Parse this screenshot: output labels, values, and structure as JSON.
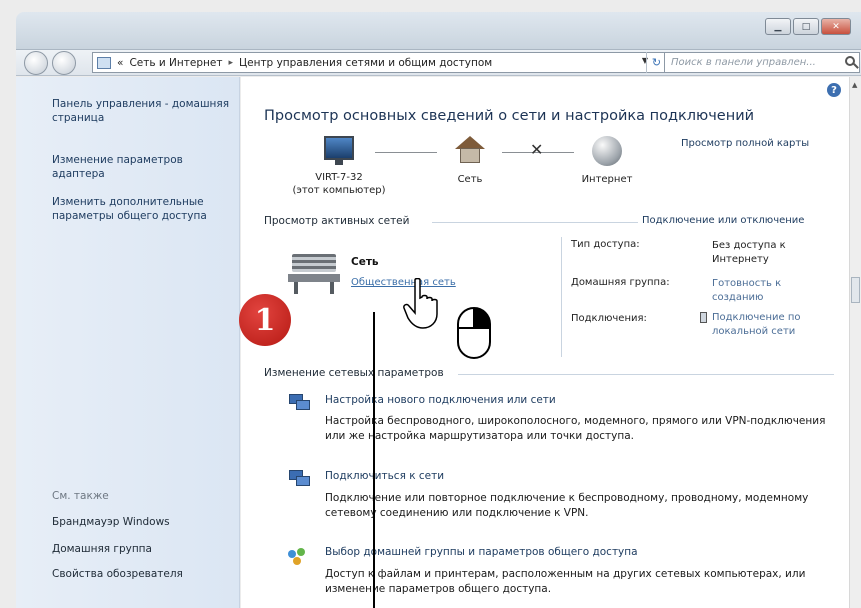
{
  "window": {
    "buttons": [
      "▁",
      "□",
      "✕"
    ]
  },
  "navbar": {
    "address_prefix": "«",
    "breadcrumb": [
      "Сеть и Интернет",
      "Центр управления сетями и общим доступом"
    ],
    "separator": "▸",
    "refresh": "↻",
    "search_placeholder": "Поиск в панели управлен..."
  },
  "sidebar": {
    "items": [
      "Панель управления - домашняя страница",
      "Изменение параметров адаптера",
      "Изменить дополнительные параметры общего доступа"
    ],
    "see_also_label": "См. также",
    "see_also_items": [
      "Брандмауэр Windows",
      "Домашняя группа",
      "Свойства обозревателя"
    ]
  },
  "main": {
    "title": "Просмотр основных сведений о сети и настройка подключений",
    "full_map_link": "Просмотр полной карты",
    "map": {
      "computer_name": "VIRT-7-32",
      "computer_sub": "(этот компьютер)",
      "network_label": "Сеть",
      "internet_label": "Интернет"
    },
    "active_networks": {
      "label": "Просмотр активных сетей",
      "action": "Подключение или отключение",
      "network_name": "Сеть",
      "network_type": "Общественная сеть",
      "access_type_label": "Тип доступа:",
      "access_type_value": "Без доступа к Интернету",
      "homegroup_label": "Домашняя группа:",
      "homegroup_value": "Готовность к созданию",
      "connections_label": "Подключения:",
      "connections_value": "Подключение по локальной сети"
    },
    "change_settings": {
      "label": "Изменение сетевых параметров",
      "tasks": [
        {
          "title": "Настройка нового подключения или сети",
          "desc": "Настройка беспроводного, широкополосного, модемного, прямого или VPN-подключения или же настройка маршрутизатора или точки доступа."
        },
        {
          "title": "Подключиться к сети",
          "desc": "Подключение или повторное подключение к беспроводному, проводному, модемному сетевому соединению или подключение к VPN."
        },
        {
          "title": "Выбор домашней группы и параметров общего доступа",
          "desc": "Доступ к файлам и принтерам, расположенным на других сетевых компьютерах, или изменение параметров общего доступа."
        }
      ]
    }
  },
  "annotation": {
    "badge_number": "1"
  }
}
